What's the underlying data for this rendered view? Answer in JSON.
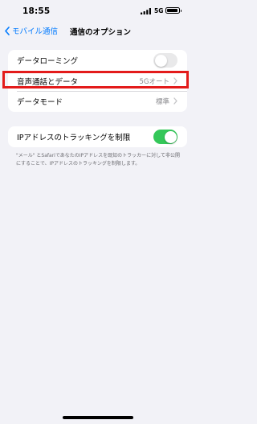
{
  "status_bar": {
    "time": "18:55",
    "network": "5G",
    "signal_bars": 4,
    "battery_level": 0.9
  },
  "nav": {
    "back_label": "モバイル通信",
    "title": "通信のオプション"
  },
  "group1": {
    "roaming": {
      "label": "データローミング",
      "enabled": false
    },
    "voice_data": {
      "label": "音声通話とデータ",
      "value": "5Gオート"
    },
    "data_mode": {
      "label": "データモード",
      "value": "標準"
    }
  },
  "group2": {
    "ip_tracking": {
      "label": "IPアドレスのトラッキングを制限",
      "enabled": true
    }
  },
  "footnote": "\"メール\" とSafariであなたのIPアドレスを既知のトラッカーに対して非公開にすることで、IPアドレスのトラッキングを制限します。",
  "colors": {
    "accent": "#007aff",
    "toggle_on": "#34c759",
    "toggle_off": "#e9e9ea",
    "highlight": "#e31b1b",
    "background": "#f2f2f7"
  }
}
